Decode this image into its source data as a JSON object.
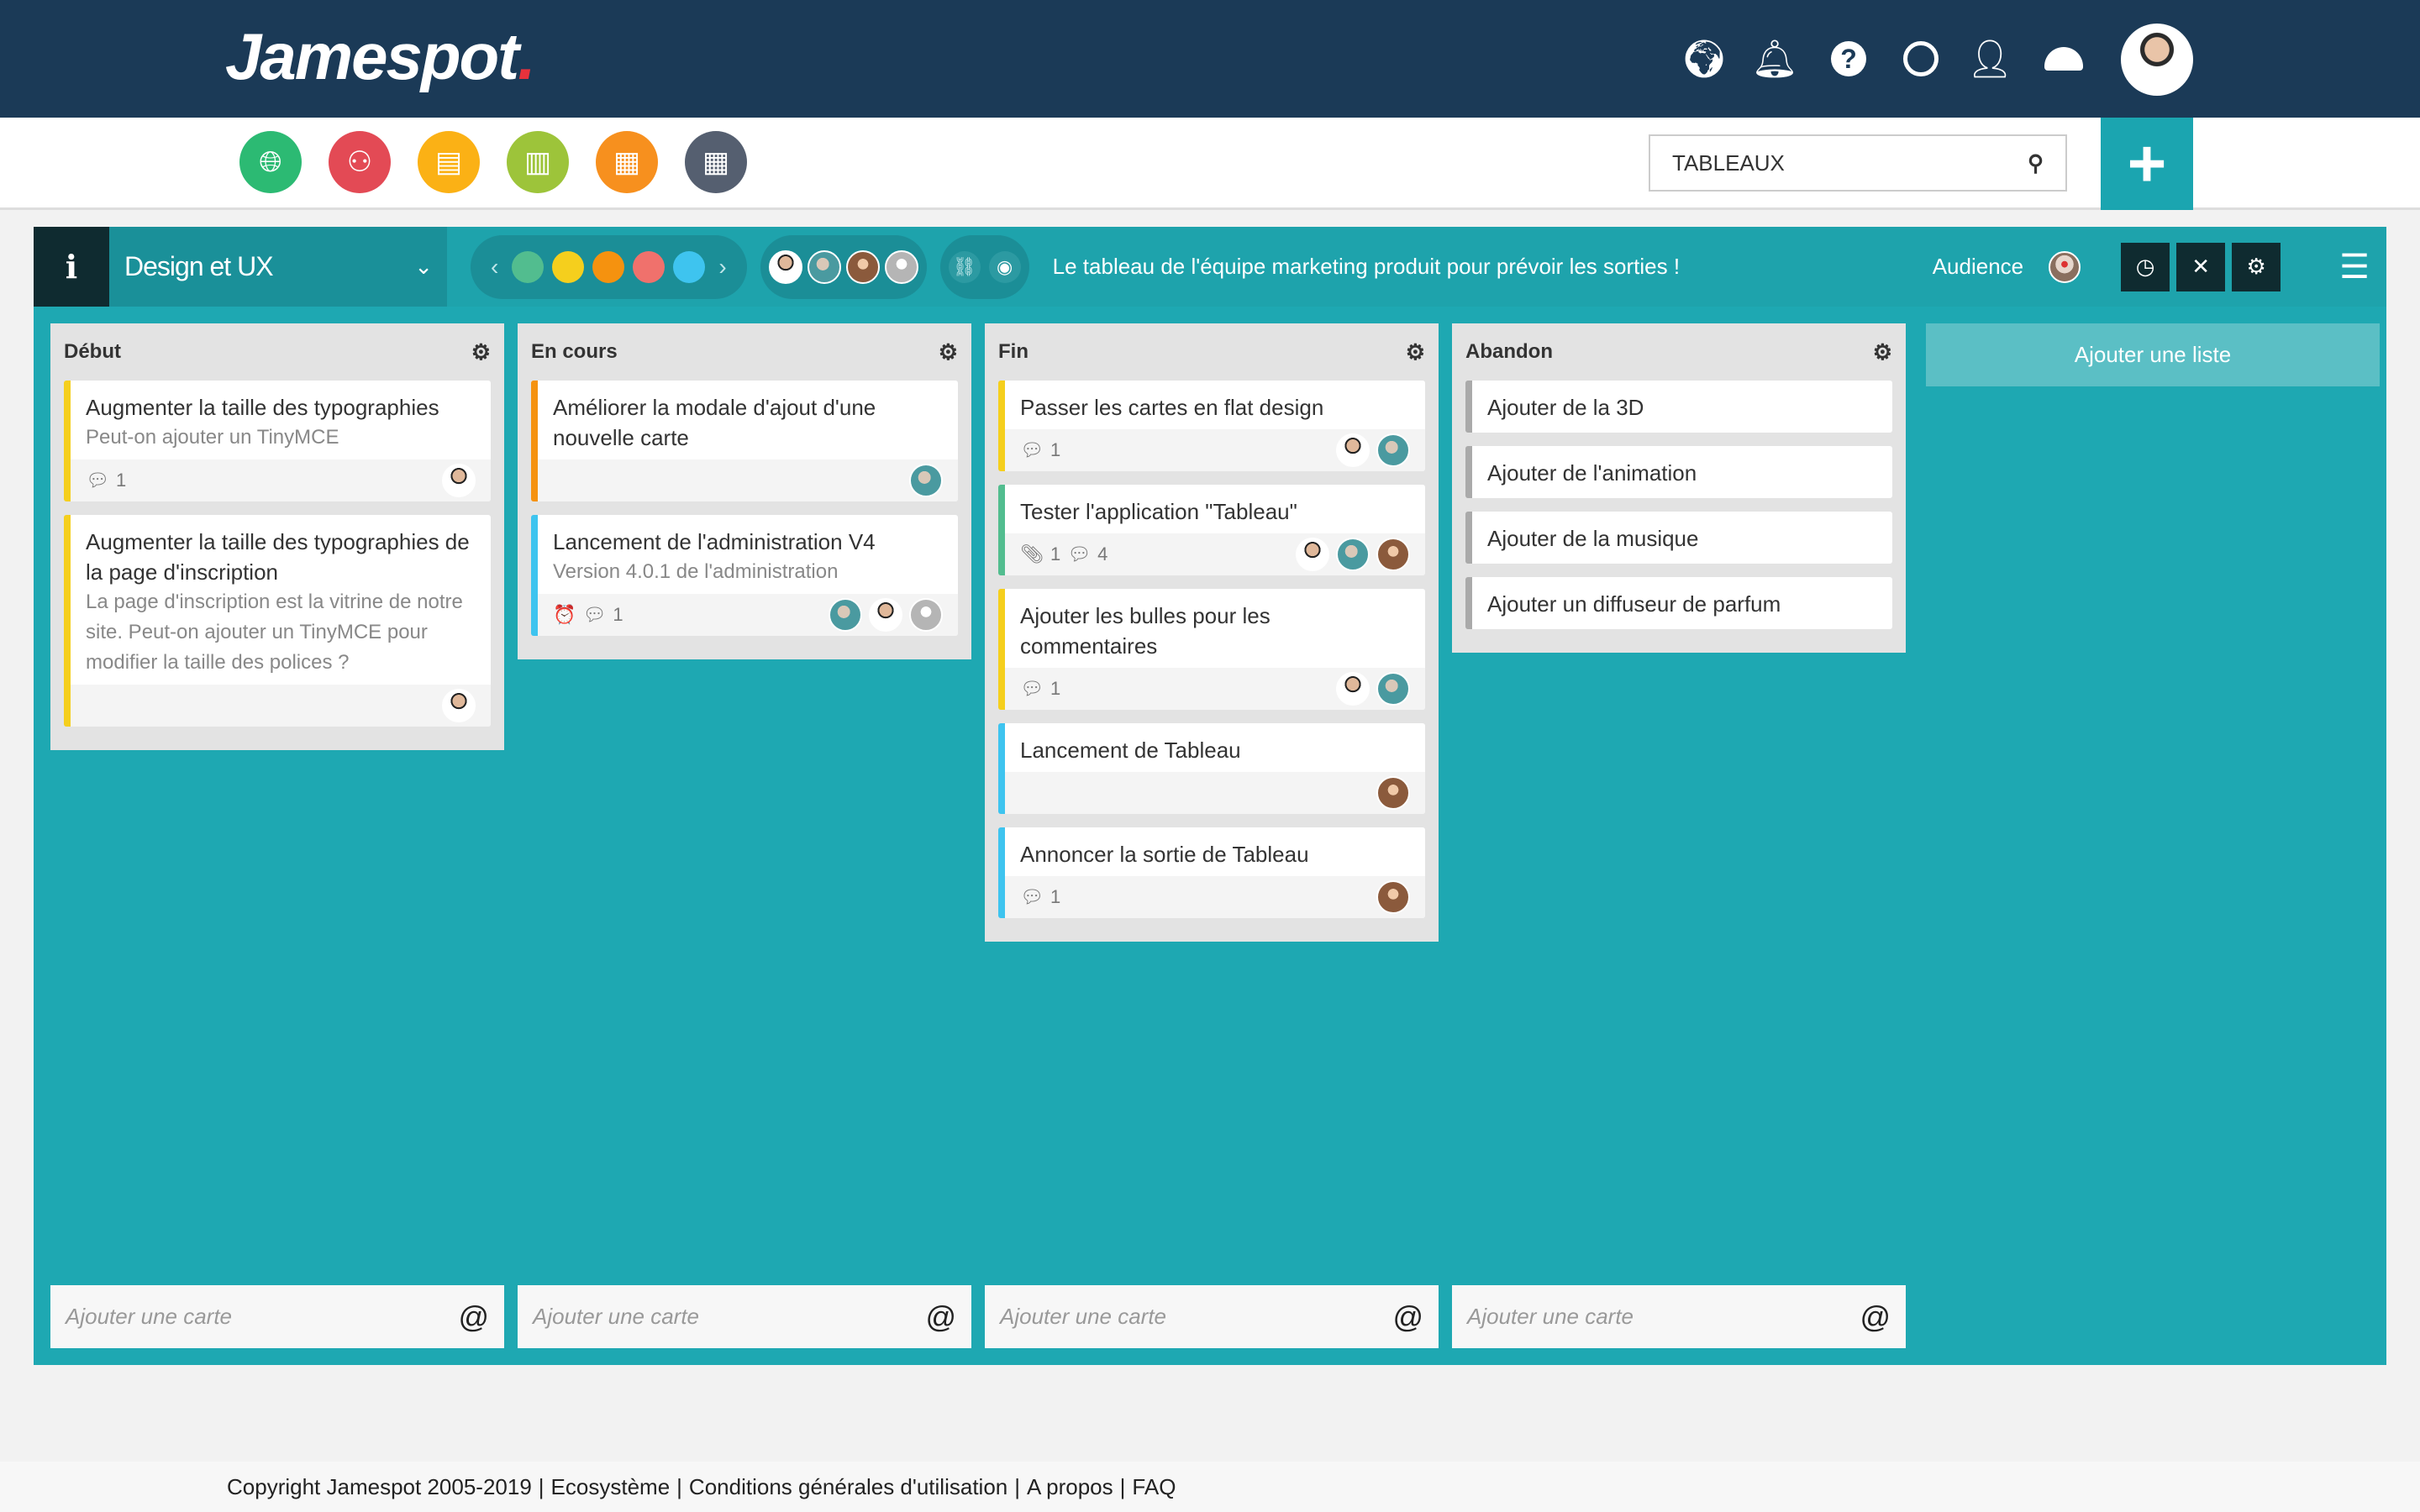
{
  "header": {
    "logo": "Jamespot",
    "logo_dot": ".",
    "icons": [
      "globe-icon",
      "bell-icon",
      "help-icon",
      "clock-icon",
      "user-icon",
      "dashboard-icon"
    ]
  },
  "apps": [
    {
      "name": "globe",
      "color": "#2cba73"
    },
    {
      "name": "users",
      "color": "#e34a55"
    },
    {
      "name": "directory",
      "color": "#fbb115"
    },
    {
      "name": "library",
      "color": "#9dc43a"
    },
    {
      "name": "calendar",
      "color": "#f7901e"
    },
    {
      "name": "apps",
      "color": "#555f70"
    }
  ],
  "search": {
    "value": "TABLEAUX"
  },
  "board": {
    "name": "Design et UX",
    "colors": [
      "#52bd8f",
      "#f5cf1d",
      "#f5920f",
      "#f0716c",
      "#3ec4ef"
    ],
    "description": "Le tableau de l'équipe marketing produit pour prévoir les sorties !",
    "audience_label": "Audience",
    "add_list": "Ajouter une liste",
    "add_card_placeholder": "Ajouter une carte",
    "at": "@"
  },
  "lists": [
    {
      "title": "Début",
      "cards": [
        {
          "title": "Augmenter la taille des typographies",
          "sub": "Peut-on ajouter un TinyMCE",
          "color": "#f5cf1d",
          "comments": "1",
          "avatars": [
            "a1"
          ]
        },
        {
          "title": "Augmenter la taille des typographies de la page d'inscription",
          "sub": "La page d'inscription est la vitrine de notre site. Peut-on ajouter un TinyMCE pour modifier la taille des polices ?",
          "color": "#f5cf1d",
          "avatars": [
            "a1"
          ]
        }
      ]
    },
    {
      "title": "En cours",
      "cards": [
        {
          "title": "Améliorer la modale d'ajout d'une nouvelle carte",
          "color": "#f5920f",
          "avatars": [
            "a2"
          ]
        },
        {
          "title": "Lancement de l'administration V4",
          "sub": "Version 4.0.1 de l'administration",
          "color": "#3ec4ef",
          "alarm": true,
          "comments": "1",
          "avatars": [
            "a2",
            "a1",
            "a4"
          ]
        }
      ]
    },
    {
      "title": "Fin",
      "cards": [
        {
          "title": "Passer les cartes en flat design",
          "color": "#f5cf1d",
          "comments": "1",
          "avatars": [
            "a1",
            "a2"
          ]
        },
        {
          "title": "Tester l'application \"Tableau\"",
          "color": "#52bd8f",
          "attachments": "1",
          "comments": "4",
          "avatars": [
            "a1",
            "a2",
            "a3"
          ]
        },
        {
          "title": "Ajouter les bulles pour les commentaires",
          "color": "#f5cf1d",
          "comments": "1",
          "avatars": [
            "a1",
            "a2"
          ]
        },
        {
          "title": "Lancement de Tableau",
          "color": "#3ec4ef",
          "avatars": [
            "a3"
          ]
        },
        {
          "title": "Annoncer la sortie de Tableau",
          "color": "#3ec4ef",
          "comments": "1",
          "avatars": [
            "a3"
          ]
        }
      ]
    },
    {
      "title": "Abandon",
      "cards": [
        {
          "title": "Ajouter de la 3D",
          "color": "#aaaaaa"
        },
        {
          "title": "Ajouter de l'animation",
          "color": "#aaaaaa"
        },
        {
          "title": "Ajouter de la musique",
          "color": "#aaaaaa"
        },
        {
          "title": "Ajouter un diffuseur de parfum",
          "color": "#aaaaaa"
        }
      ]
    }
  ],
  "footer": [
    "Copyright Jamespot 2005-2019",
    "|",
    "Ecosystème",
    "|",
    "Conditions générales d'utilisation",
    "|",
    "A propos",
    "|",
    "FAQ"
  ]
}
